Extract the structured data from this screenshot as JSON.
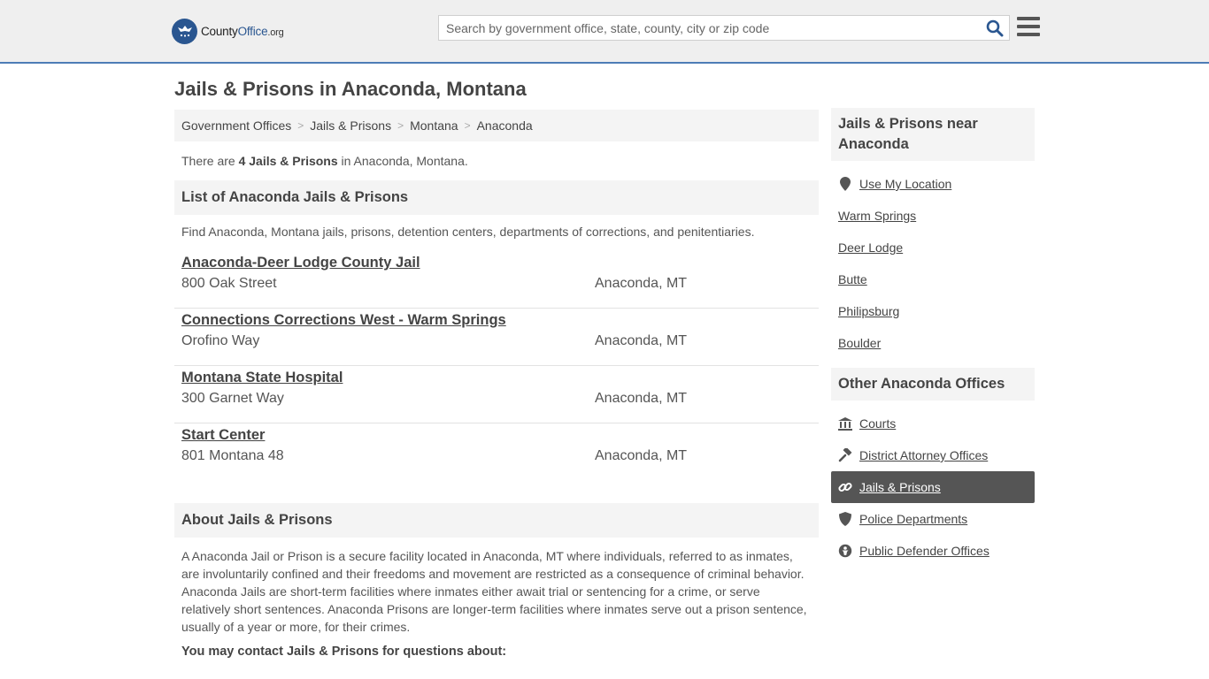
{
  "header": {
    "logo": {
      "part1": "County",
      "part2": "Office",
      "tld": ".org"
    },
    "search_placeholder": "Search by government office, state, county, city or zip code"
  },
  "page_title": "Jails & Prisons in Anaconda, Montana",
  "breadcrumb": [
    "Government Offices",
    "Jails & Prisons",
    "Montana",
    "Anaconda"
  ],
  "count_line": {
    "prefix": "There are ",
    "bold": "4 Jails & Prisons",
    "suffix": " in Anaconda, Montana."
  },
  "list_section": {
    "heading": "List of Anaconda Jails & Prisons",
    "description": "Find Anaconda, Montana jails, prisons, detention centers, departments of corrections, and penitentiaries.",
    "items": [
      {
        "name": "Anaconda-Deer Lodge County Jail",
        "address": "800 Oak Street",
        "city": "Anaconda, MT"
      },
      {
        "name": "Connections Corrections West - Warm Springs",
        "address": "Orofino Way",
        "city": "Anaconda, MT"
      },
      {
        "name": "Montana State Hospital",
        "address": "300 Garnet Way",
        "city": "Anaconda, MT"
      },
      {
        "name": "Start Center",
        "address": "801 Montana 48",
        "city": "Anaconda, MT"
      }
    ]
  },
  "about": {
    "heading": "About Jails & Prisons",
    "text": "A Anaconda Jail or Prison is a secure facility located in Anaconda, MT where individuals, referred to as inmates, are involuntarily confined and their freedoms and movement are restricted as a consequence of criminal behavior. Anaconda Jails are short-term facilities where inmates either await trial or sentencing for a crime, or serve relatively short sentences. Anaconda Prisons are longer-term facilities where inmates serve out a prison sentence, usually of a year or more, for their crimes.",
    "contact_heading": "You may contact Jails & Prisons for questions about:"
  },
  "sidebar": {
    "near_heading": "Jails & Prisons near Anaconda",
    "near_items": [
      {
        "label": "Use My Location",
        "icon": "location-pin-icon"
      },
      {
        "label": "Warm Springs"
      },
      {
        "label": "Deer Lodge"
      },
      {
        "label": "Butte"
      },
      {
        "label": "Philipsburg"
      },
      {
        "label": "Boulder"
      }
    ],
    "other_heading": "Other Anaconda Offices",
    "other_items": [
      {
        "label": "Courts",
        "icon": "courthouse-icon",
        "active": false
      },
      {
        "label": "District Attorney Offices",
        "icon": "gavel-icon",
        "active": false
      },
      {
        "label": "Jails & Prisons",
        "icon": "chain-link-icon",
        "active": true
      },
      {
        "label": "Police Departments",
        "icon": "shield-icon",
        "active": false
      },
      {
        "label": "Public Defender Offices",
        "icon": "person-circle-icon",
        "active": false
      }
    ]
  },
  "colors": {
    "accent_blue": "#2a5690",
    "header_border": "#4d7cb6",
    "active_item_bg": "#555555"
  }
}
